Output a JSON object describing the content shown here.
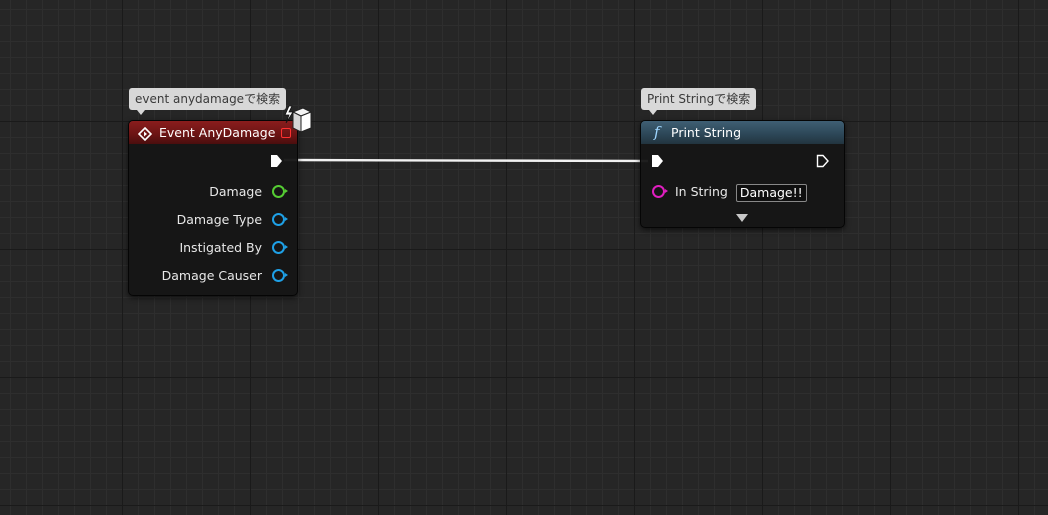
{
  "event_node": {
    "tooltip": "event anydamageで検索",
    "title": "Event AnyDamage",
    "pins": [
      "Damage",
      "Damage Type",
      "Instigated By",
      "Damage Causer"
    ],
    "pin_colors": [
      "#55cc33",
      "#1ea0e6",
      "#1ea0e6",
      "#1ea0e6"
    ],
    "delegate_color": "#ff3030"
  },
  "print_node": {
    "tooltip": "Print Stringで検索",
    "title": "Print String",
    "function_symbol": "f",
    "input_label": "In String",
    "input_value": "Damage!!",
    "input_color": "#e01ec0",
    "advanced_icon": "expand-arrow-icon"
  },
  "icons": {
    "event": "event-diamond-icon",
    "replication": "network-replication-icon",
    "exec": "exec-pin-icon"
  }
}
